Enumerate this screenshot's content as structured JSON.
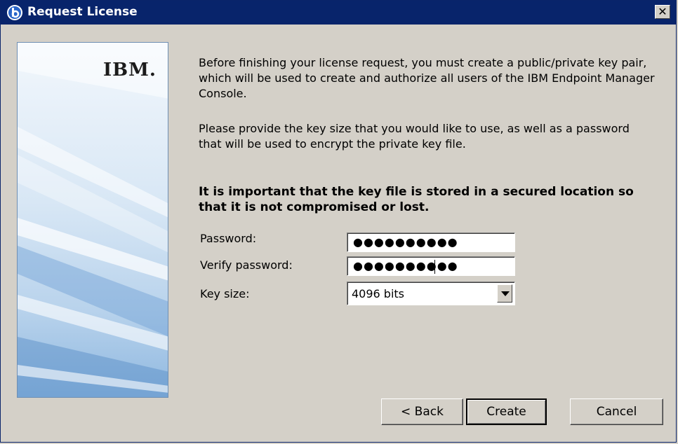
{
  "window": {
    "title": "Request License",
    "close_label": "✕"
  },
  "banner": {
    "logo_text": "IBM."
  },
  "content": {
    "intro_paragraph": "Before finishing your license request, you must create a public/private key pair, which will be used to create and authorize all users of the IBM Endpoint Manager Console.",
    "instruction_paragraph": "Please provide the key size that you would like to use, as well as a password that will be used to encrypt the private key file.",
    "important_notice": "It is important that the key file is stored in a secured location so that it is not compromised or lost."
  },
  "form": {
    "password_label": "Password:",
    "password_value": "●●●●●●●●●●",
    "verify_label": "Verify password:",
    "verify_value": "●●●●●●●●●●",
    "key_size_label": "Key size:",
    "key_size_value": "4096 bits"
  },
  "buttons": {
    "back": "< Back",
    "create": "Create",
    "cancel": "Cancel"
  },
  "colors": {
    "titlebar": "#08246b",
    "dialog_bg": "#d4d0c8",
    "banner_blue": "#8fb8e0"
  }
}
